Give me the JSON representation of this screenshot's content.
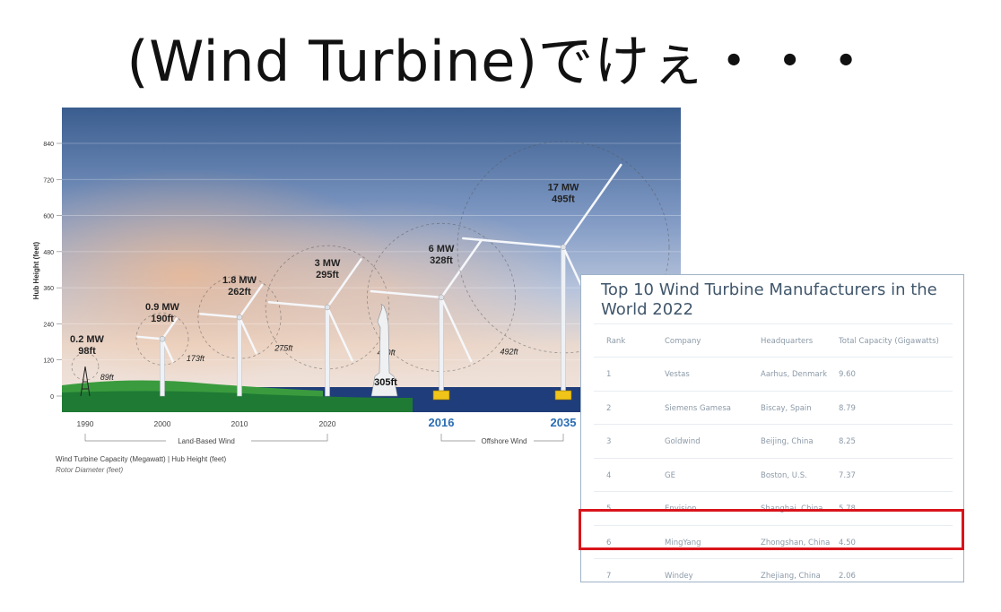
{
  "slide": {
    "title": "(Wind Turbine)でけぇ・・・"
  },
  "chart_data": {
    "type": "bar",
    "ylabel": "Hub Height (feet)",
    "yticks": [
      0,
      120,
      240,
      360,
      480,
      600,
      720,
      840
    ],
    "ylim": [
      0,
      900
    ],
    "categories": [
      "1990",
      "2000",
      "2010",
      "2020",
      "2016",
      "2035"
    ],
    "turbines": [
      {
        "year": "1990",
        "capacity": "0.2 MW",
        "hub": "98ft",
        "hub_ft": 98,
        "rotor": "89ft",
        "rotor_ft": 89,
        "type": "land"
      },
      {
        "year": "2000",
        "capacity": "0.9 MW",
        "hub": "190ft",
        "hub_ft": 190,
        "rotor": "173ft",
        "rotor_ft": 173,
        "type": "land"
      },
      {
        "year": "2010",
        "capacity": "1.8 MW",
        "hub": "262ft",
        "hub_ft": 262,
        "rotor": "275ft",
        "rotor_ft": 275,
        "type": "land"
      },
      {
        "year": "2020",
        "capacity": "3 MW",
        "hub": "295ft",
        "hub_ft": 295,
        "rotor": "410ft",
        "rotor_ft": 410,
        "type": "land"
      },
      {
        "year": "2016",
        "capacity": "6 MW",
        "hub": "328ft",
        "hub_ft": 328,
        "rotor": "492ft",
        "rotor_ft": 492,
        "type": "offshore"
      },
      {
        "year": "2035",
        "capacity": "17 MW",
        "hub": "495ft",
        "hub_ft": 495,
        "rotor": "",
        "rotor_ft": 820,
        "type": "offshore"
      }
    ],
    "statue": {
      "label": "305ft",
      "height_ft": 305
    },
    "groups": {
      "land": "Land-Based Wind",
      "offshore": "Offshore Wind"
    },
    "legend": {
      "line1": "Wind Turbine Capacity (Megawatt) | Hub Height (feet)",
      "line2": "Rotor Diameter (feet)"
    }
  },
  "table": {
    "title_line1": "Top 10 Wind Turbine Manufacturers in the",
    "title_line2": "World 2022",
    "headers": [
      "Rank",
      "Company",
      "Headquarters",
      "Total Capacity (Gigawatts)"
    ],
    "rows": [
      [
        "1",
        "Vestas",
        "Aarhus, Denmark",
        "9.60"
      ],
      [
        "2",
        "Siemens Gamesa",
        "Biscay, Spain",
        "8.79"
      ],
      [
        "3",
        "Goldwind",
        "Beijing, China",
        "8.25"
      ],
      [
        "4",
        "GE",
        "Boston, U.S.",
        "7.37"
      ],
      [
        "5",
        "Envision",
        "Shanghai, China",
        "5.78"
      ],
      [
        "6",
        "MingYang",
        "Zhongshan, China",
        "4.50"
      ],
      [
        "7",
        "Windey",
        "Zhejiang, China",
        "2.06"
      ]
    ],
    "highlight_rank": "6",
    "highlight_color": "#d9141b"
  }
}
